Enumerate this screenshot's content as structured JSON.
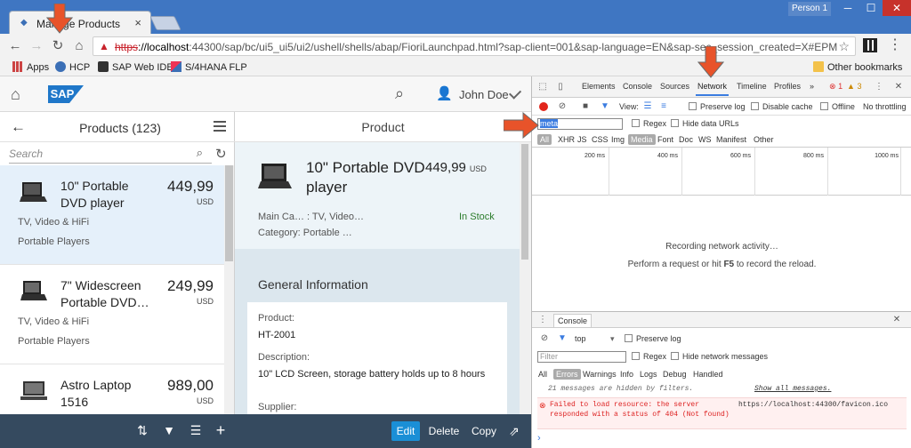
{
  "browser": {
    "tab_title": "Manage Products",
    "tab_close": "×",
    "profile": "Person 1",
    "url_scheme": "https",
    "url_host": "://localhost",
    "url_rest": ":44300/sap/bc/ui5_ui5/ui2/ushell/shells/abap/FioriLaunchpad.html?sap-client=001&sap-language=EN&sap-sec_session_created=X#EPMProduct-r",
    "bookmarks": [
      "Apps",
      "HCP",
      "SAP Web IDE",
      "S/4HANA FLP"
    ],
    "other_bookmarks": "Other bookmarks"
  },
  "shell": {
    "logo": "SAP",
    "user": "John Doe"
  },
  "master": {
    "title": "Products (123)",
    "search_placeholder": "Search",
    "items": [
      {
        "name": "10\" Portable DVD player",
        "price": "449,99",
        "currency": "USD",
        "category": "TV, Video & HiFi",
        "subcategory": "Portable Players"
      },
      {
        "name": "7\" Widescreen Portable DVD…",
        "price": "249,99",
        "currency": "USD",
        "category": "TV, Video & HiFi",
        "subcategory": "Portable Players"
      },
      {
        "name": "Astro Laptop 1516",
        "price": "989,00",
        "currency": "USD",
        "category": "",
        "subcategory": ""
      }
    ]
  },
  "detail": {
    "title": "Product",
    "product_name": "10\" Portable DVD player",
    "price": "449,99",
    "currency": "USD",
    "main_category": "Main Ca… : TV, Video…",
    "category": "Category: Portable …",
    "status": "In Stock",
    "section_title": "General Information",
    "product_label": "Product:",
    "product_value": "HT-2001",
    "description_label": "Description:",
    "description_value": "10\" LCD Screen, storage battery holds up to 8 hours",
    "supplier_label": "Supplier:",
    "footer": {
      "edit": "Edit",
      "delete": "Delete",
      "copy": "Copy"
    }
  },
  "devtools": {
    "tabs": [
      "Elements",
      "Console",
      "Sources",
      "Network",
      "Timeline",
      "Profiles"
    ],
    "more": "»",
    "errors": "1",
    "warnings": "3",
    "view_label": "View:",
    "preserve_log": "Preserve log",
    "disable_cache": "Disable cache",
    "offline": "Offline",
    "throttling": "No throttling",
    "filter_value": "meta",
    "regex": "Regex",
    "hide_data_urls": "Hide data URLs",
    "types": [
      "All",
      "XHR",
      "JS",
      "CSS",
      "Img",
      "Media",
      "Font",
      "Doc",
      "WS",
      "Manifest",
      "Other"
    ],
    "timeline_labels": [
      "200 ms",
      "400 ms",
      "600 ms",
      "800 ms",
      "1000 ms"
    ],
    "recording": "Recording network activity…",
    "reload_hint_prefix": "Perform a request or hit ",
    "reload_key": "F5",
    "reload_hint_suffix": " to record the reload.",
    "console": {
      "tab": "Console",
      "context": "top",
      "preserve_log": "Preserve log",
      "filter_placeholder": "Filter",
      "regex": "Regex",
      "hide_network": "Hide network messages",
      "levels": [
        "All",
        "Errors",
        "Warnings",
        "Info",
        "Logs",
        "Debug",
        "Handled"
      ],
      "hidden_msg": "21 messages are hidden by filters.",
      "show_all": "Show all messages.",
      "error_line1": "Failed to load resource: the server",
      "error_line2": "responded with a status of 404 (Not found)",
      "error_source": "https://localhost:44300/favicon.ico",
      "prompt": "›"
    }
  },
  "colors": {
    "accent": "#1a8fd6",
    "annotation_arrow": "#e8532a",
    "footer": "#354a5f"
  }
}
